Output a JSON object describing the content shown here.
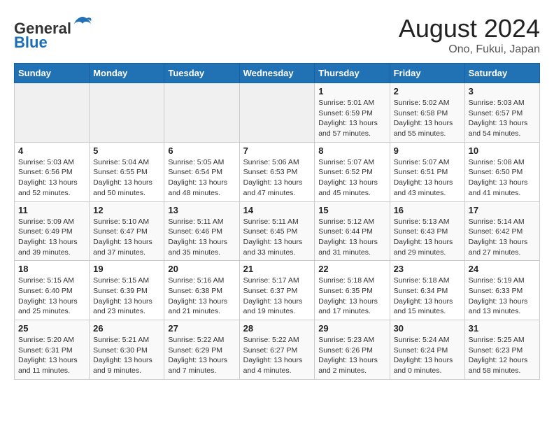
{
  "header": {
    "logo_line1": "General",
    "logo_line2": "Blue",
    "month_year": "August 2024",
    "location": "Ono, Fukui, Japan"
  },
  "weekdays": [
    "Sunday",
    "Monday",
    "Tuesday",
    "Wednesday",
    "Thursday",
    "Friday",
    "Saturday"
  ],
  "weeks": [
    [
      {
        "day": "",
        "info": ""
      },
      {
        "day": "",
        "info": ""
      },
      {
        "day": "",
        "info": ""
      },
      {
        "day": "",
        "info": ""
      },
      {
        "day": "1",
        "info": "Sunrise: 5:01 AM\nSunset: 6:59 PM\nDaylight: 13 hours\nand 57 minutes."
      },
      {
        "day": "2",
        "info": "Sunrise: 5:02 AM\nSunset: 6:58 PM\nDaylight: 13 hours\nand 55 minutes."
      },
      {
        "day": "3",
        "info": "Sunrise: 5:03 AM\nSunset: 6:57 PM\nDaylight: 13 hours\nand 54 minutes."
      }
    ],
    [
      {
        "day": "4",
        "info": "Sunrise: 5:03 AM\nSunset: 6:56 PM\nDaylight: 13 hours\nand 52 minutes."
      },
      {
        "day": "5",
        "info": "Sunrise: 5:04 AM\nSunset: 6:55 PM\nDaylight: 13 hours\nand 50 minutes."
      },
      {
        "day": "6",
        "info": "Sunrise: 5:05 AM\nSunset: 6:54 PM\nDaylight: 13 hours\nand 48 minutes."
      },
      {
        "day": "7",
        "info": "Sunrise: 5:06 AM\nSunset: 6:53 PM\nDaylight: 13 hours\nand 47 minutes."
      },
      {
        "day": "8",
        "info": "Sunrise: 5:07 AM\nSunset: 6:52 PM\nDaylight: 13 hours\nand 45 minutes."
      },
      {
        "day": "9",
        "info": "Sunrise: 5:07 AM\nSunset: 6:51 PM\nDaylight: 13 hours\nand 43 minutes."
      },
      {
        "day": "10",
        "info": "Sunrise: 5:08 AM\nSunset: 6:50 PM\nDaylight: 13 hours\nand 41 minutes."
      }
    ],
    [
      {
        "day": "11",
        "info": "Sunrise: 5:09 AM\nSunset: 6:49 PM\nDaylight: 13 hours\nand 39 minutes."
      },
      {
        "day": "12",
        "info": "Sunrise: 5:10 AM\nSunset: 6:47 PM\nDaylight: 13 hours\nand 37 minutes."
      },
      {
        "day": "13",
        "info": "Sunrise: 5:11 AM\nSunset: 6:46 PM\nDaylight: 13 hours\nand 35 minutes."
      },
      {
        "day": "14",
        "info": "Sunrise: 5:11 AM\nSunset: 6:45 PM\nDaylight: 13 hours\nand 33 minutes."
      },
      {
        "day": "15",
        "info": "Sunrise: 5:12 AM\nSunset: 6:44 PM\nDaylight: 13 hours\nand 31 minutes."
      },
      {
        "day": "16",
        "info": "Sunrise: 5:13 AM\nSunset: 6:43 PM\nDaylight: 13 hours\nand 29 minutes."
      },
      {
        "day": "17",
        "info": "Sunrise: 5:14 AM\nSunset: 6:42 PM\nDaylight: 13 hours\nand 27 minutes."
      }
    ],
    [
      {
        "day": "18",
        "info": "Sunrise: 5:15 AM\nSunset: 6:40 PM\nDaylight: 13 hours\nand 25 minutes."
      },
      {
        "day": "19",
        "info": "Sunrise: 5:15 AM\nSunset: 6:39 PM\nDaylight: 13 hours\nand 23 minutes."
      },
      {
        "day": "20",
        "info": "Sunrise: 5:16 AM\nSunset: 6:38 PM\nDaylight: 13 hours\nand 21 minutes."
      },
      {
        "day": "21",
        "info": "Sunrise: 5:17 AM\nSunset: 6:37 PM\nDaylight: 13 hours\nand 19 minutes."
      },
      {
        "day": "22",
        "info": "Sunrise: 5:18 AM\nSunset: 6:35 PM\nDaylight: 13 hours\nand 17 minutes."
      },
      {
        "day": "23",
        "info": "Sunrise: 5:18 AM\nSunset: 6:34 PM\nDaylight: 13 hours\nand 15 minutes."
      },
      {
        "day": "24",
        "info": "Sunrise: 5:19 AM\nSunset: 6:33 PM\nDaylight: 13 hours\nand 13 minutes."
      }
    ],
    [
      {
        "day": "25",
        "info": "Sunrise: 5:20 AM\nSunset: 6:31 PM\nDaylight: 13 hours\nand 11 minutes."
      },
      {
        "day": "26",
        "info": "Sunrise: 5:21 AM\nSunset: 6:30 PM\nDaylight: 13 hours\nand 9 minutes."
      },
      {
        "day": "27",
        "info": "Sunrise: 5:22 AM\nSunset: 6:29 PM\nDaylight: 13 hours\nand 7 minutes."
      },
      {
        "day": "28",
        "info": "Sunrise: 5:22 AM\nSunset: 6:27 PM\nDaylight: 13 hours\nand 4 minutes."
      },
      {
        "day": "29",
        "info": "Sunrise: 5:23 AM\nSunset: 6:26 PM\nDaylight: 13 hours\nand 2 minutes."
      },
      {
        "day": "30",
        "info": "Sunrise: 5:24 AM\nSunset: 6:24 PM\nDaylight: 13 hours\nand 0 minutes."
      },
      {
        "day": "31",
        "info": "Sunrise: 5:25 AM\nSunset: 6:23 PM\nDaylight: 12 hours\nand 58 minutes."
      }
    ]
  ]
}
